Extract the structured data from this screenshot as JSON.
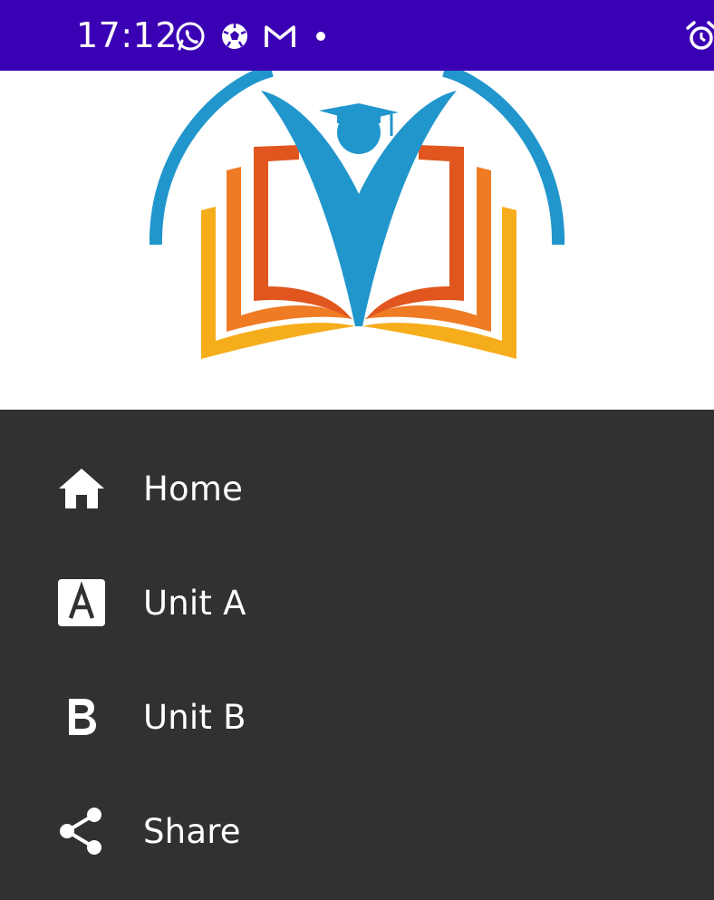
{
  "status_bar": {
    "time": "17:12",
    "notification_icons": [
      "whatsapp-icon",
      "football-icon",
      "gmail-icon",
      "dot-icon"
    ],
    "right_icons": [
      "alarm-icon"
    ],
    "background_color": "#3a00b3"
  },
  "drawer_header": {
    "logo": "open-book-graduate-logo",
    "logo_colors": {
      "arc_and_figure": "#2196cc",
      "inner_pages": "#e0561e",
      "middle_pages": "#ef7b24",
      "outer_pages": "#f6ad1c"
    }
  },
  "menu": {
    "background_color": "#313131",
    "items": [
      {
        "icon": "home-icon",
        "label": "Home"
      },
      {
        "icon": "letter-a-box-icon",
        "label": "Unit A"
      },
      {
        "icon": "letter-b-icon",
        "label": "Unit B"
      },
      {
        "icon": "share-icon",
        "label": "Share"
      }
    ]
  }
}
